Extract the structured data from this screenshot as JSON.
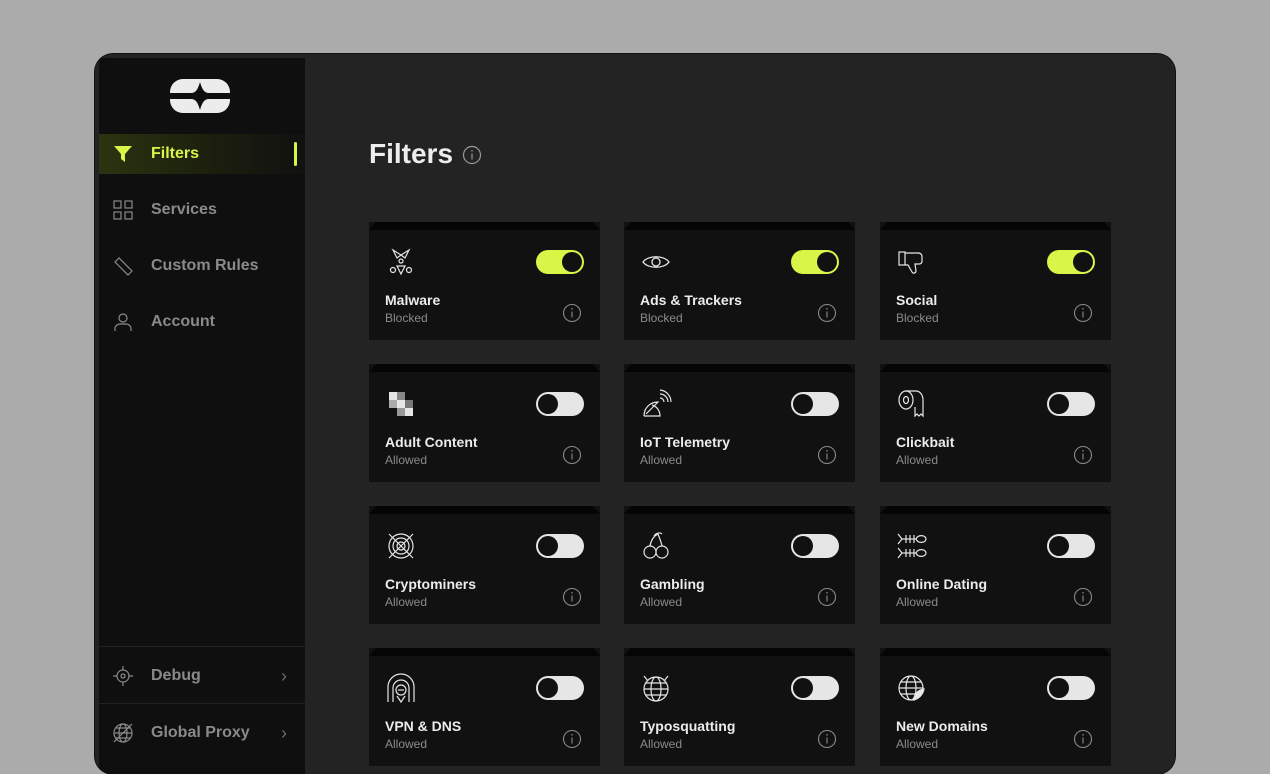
{
  "sidebar": {
    "items": [
      {
        "label": "Filters",
        "icon": "filter-icon",
        "active": true
      },
      {
        "label": "Services",
        "icon": "grid-icon",
        "active": false
      },
      {
        "label": "Custom Rules",
        "icon": "pencil-icon",
        "active": false
      },
      {
        "label": "Account",
        "icon": "user-icon",
        "active": false
      }
    ],
    "bottom": [
      {
        "label": "Debug",
        "icon": "crosshair-icon"
      },
      {
        "label": "Global Proxy",
        "icon": "globe-icon"
      }
    ]
  },
  "main": {
    "title": "Filters",
    "cards": [
      {
        "name": "Malware",
        "status": "Blocked",
        "enabled": true,
        "icon": "radiation-icon"
      },
      {
        "name": "Ads & Trackers",
        "status": "Blocked",
        "enabled": true,
        "icon": "eye-icon"
      },
      {
        "name": "Social",
        "status": "Blocked",
        "enabled": true,
        "icon": "thumbs-down-icon"
      },
      {
        "name": "Adult Content",
        "status": "Allowed",
        "enabled": false,
        "icon": "pixelated-icon"
      },
      {
        "name": "IoT Telemetry",
        "status": "Allowed",
        "enabled": false,
        "icon": "satellite-dish-icon"
      },
      {
        "name": "Clickbait",
        "status": "Allowed",
        "enabled": false,
        "icon": "toilet-paper-icon"
      },
      {
        "name": "Cryptominers",
        "status": "Allowed",
        "enabled": false,
        "icon": "crypto-coin-icon"
      },
      {
        "name": "Gambling",
        "status": "Allowed",
        "enabled": false,
        "icon": "cherries-icon"
      },
      {
        "name": "Online Dating",
        "status": "Allowed",
        "enabled": false,
        "icon": "fish-bones-icon"
      },
      {
        "name": "VPN & DNS",
        "status": "Allowed",
        "enabled": false,
        "icon": "tunnel-icon"
      },
      {
        "name": "Typosquatting",
        "status": "Allowed",
        "enabled": false,
        "icon": "devil-globe-icon"
      },
      {
        "name": "New Domains",
        "status": "Allowed",
        "enabled": false,
        "icon": "peeled-globe-icon"
      }
    ]
  },
  "colors": {
    "accent": "#d9f548",
    "background": "#232323",
    "sidebar": "#0f0f0f",
    "card": "#111111"
  }
}
